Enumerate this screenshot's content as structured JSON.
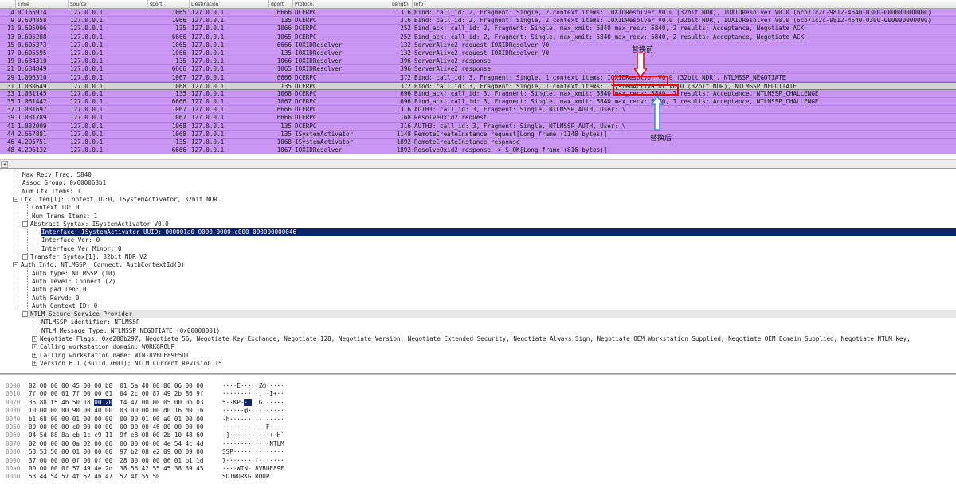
{
  "packet_list": {
    "columns": [
      "Time",
      "Source",
      "sport",
      "Destination",
      "dport",
      "Protoco.",
      "Length",
      "Info"
    ],
    "rows": [
      {
        "no": "4",
        "time": "0.165914",
        "src": "127.0.0.1",
        "sport": "1065",
        "dst": "127.0.0.1",
        "dport": "6666",
        "proto": "DCERPC",
        "len": "316",
        "info": "Bind: call_id: 2, Fragment: Single, 2 context items: IOXIDResolver V0.0 (32bit NDR), IOXIDResolver V0.0 (6cb71c2c-9812-4540-0300-000000000000)"
      },
      {
        "no": "9",
        "time": "0.604858",
        "src": "127.0.0.1",
        "sport": "1066",
        "dst": "127.0.0.1",
        "dport": "135",
        "proto": "DCERPC",
        "len": "316",
        "info": "Bind: call_id: 2, Fragment: Single, 2 context items: IOXIDResolver V0.0 (32bit NDR), IOXIDResolver V0.0 (6cb71c2c-9812-4540-0300-000000000000)"
      },
      {
        "no": "11",
        "time": "0.605006",
        "src": "127.0.0.1",
        "sport": "135",
        "dst": "127.0.0.1",
        "dport": "1066",
        "proto": "DCERPC",
        "len": "252",
        "info": "Bind_ack: call_id: 2, Fragment: Single, max_xmit: 5840 max_recv: 5840, 2 results: Acceptance, Negotiate ACK"
      },
      {
        "no": "13",
        "time": "0.605288",
        "src": "127.0.0.1",
        "sport": "6666",
        "dst": "127.0.0.1",
        "dport": "1065",
        "proto": "DCERPC",
        "len": "252",
        "info": "Bind_ack: call_id: 2, Fragment: Single, max_xmit: 5840 max_recv: 5840, 2 results: Acceptance, Negotiate ACK"
      },
      {
        "no": "15",
        "time": "0.605373",
        "src": "127.0.0.1",
        "sport": "1065",
        "dst": "127.0.0.1",
        "dport": "6666",
        "proto": "IOXIDResolver",
        "len": "132",
        "info": "ServerAlive2 request IOXIDResolver V0"
      },
      {
        "no": "17",
        "time": "0.605595",
        "src": "127.0.0.1",
        "sport": "1066",
        "dst": "127.0.0.1",
        "dport": "135",
        "proto": "IOXIDResolver",
        "len": "132",
        "info": "ServerAlive2 request IOXIDResolver V0"
      },
      {
        "no": "19",
        "time": "0.634310",
        "src": "127.0.0.1",
        "sport": "135",
        "dst": "127.0.0.1",
        "dport": "1066",
        "proto": "IOXIDResolver",
        "len": "396",
        "info": "ServerAlive2 response"
      },
      {
        "no": "21",
        "time": "0.634849",
        "src": "127.0.0.1",
        "sport": "6666",
        "dst": "127.0.0.1",
        "dport": "1065",
        "proto": "IOXIDResolver",
        "len": "396",
        "info": "ServerAlive2 response"
      },
      {
        "no": "29",
        "time": "1.006310",
        "src": "127.0.0.1",
        "sport": "1067",
        "dst": "127.0.0.1",
        "dport": "6666",
        "proto": "DCERPC",
        "len": "372",
        "info": "Bind: call_id: 3, Fragment: Single, 1 context items: IOXIDResolver V0.0 (32bit NDR), NTLMSSP_NEGOTIATE"
      },
      {
        "no": "31",
        "time": "1.030649",
        "src": "127.0.0.1",
        "sport": "1068",
        "dst": "127.0.0.1",
        "dport": "135",
        "proto": "DCERPC",
        "len": "372",
        "info": "Bind: call_id: 3, Fragment: Single, 1 context items: ISystemActivator V0.0 (32bit NDR), NTLMSSP_NEGOTIATE",
        "selected": true
      },
      {
        "no": "33",
        "time": "1.031145",
        "src": "127.0.0.1",
        "sport": "135",
        "dst": "127.0.0.1",
        "dport": "1068",
        "proto": "DCERPC",
        "len": "696",
        "info": "Bind_ack: call_id: 3, Fragment: Single, max_xmit: 5840 max_recv: 5840, 1 results: Acceptance, NTLMSSP_CHALLENGE"
      },
      {
        "no": "35",
        "time": "1.051442",
        "src": "127.0.0.1",
        "sport": "6666",
        "dst": "127.0.0.1",
        "dport": "1067",
        "proto": "DCERPC",
        "len": "696",
        "info": "Bind_ack: call_id: 3, Fragment: Single, max_xmit: 5840 max_recv: 5840, 1 results: Acceptance, NTLMSSP_CHALLENGE"
      },
      {
        "no": "37",
        "time": "1.031697",
        "src": "127.0.0.1",
        "sport": "1067",
        "dst": "127.0.0.1",
        "dport": "6666",
        "proto": "DCERPC",
        "len": "316",
        "info": "AUTH3: call_id: 3, Fragment: Single, NTLMSSP_AUTH, User: \\"
      },
      {
        "no": "39",
        "time": "1.031789",
        "src": "127.0.0.1",
        "sport": "1067",
        "dst": "127.0.0.1",
        "dport": "6666",
        "proto": "DCERPC",
        "len": "168",
        "info": "ResolveOxid2 request"
      },
      {
        "no": "41",
        "time": "1.032009",
        "src": "127.0.0.1",
        "sport": "1068",
        "dst": "127.0.0.1",
        "dport": "135",
        "proto": "DCERPC",
        "len": "316",
        "info": "AUTH3: call_id: 3, Fragment: Single, NTLMSSP_AUTH, User: \\"
      },
      {
        "no": "44",
        "time": "2.657881",
        "src": "127.0.0.1",
        "sport": "1068",
        "dst": "127.0.0.1",
        "dport": "135",
        "proto": "ISystemActivator",
        "len": "1148",
        "info": "RemoteCreateInstance request[Long frame (1148 bytes)]"
      },
      {
        "no": "46",
        "time": "4.295751",
        "src": "127.0.0.1",
        "sport": "135",
        "dst": "127.0.0.1",
        "dport": "1068",
        "proto": "ISystemActivator",
        "len": "1892",
        "info": "RemoteCreateInstance response"
      },
      {
        "no": "48",
        "time": "4.296132",
        "src": "127.0.0.1",
        "sport": "6666",
        "dst": "127.0.0.1",
        "dport": "1067",
        "proto": "IOXIDResolver",
        "len": "1892",
        "info": "ResolveOxid2 response -> S_OK[Long frame (816 bytes)]"
      }
    ]
  },
  "annotations": {
    "before_label": "替换前",
    "after_label": "替换后",
    "arrow_color": "#e01010",
    "arrow_after_color": "#3a8fe0"
  },
  "details": {
    "rows": [
      {
        "text": "Max Recv Frag: 5840"
      },
      {
        "text": "Assoc Group: 0x000068b1"
      },
      {
        "text": "Num Ctx Items: 1"
      },
      {
        "text": "Ctx Item[1]: Context ID:0, ISystemActivator, 32bit NDR",
        "exp": "-"
      },
      {
        "text": "Context ID: 0"
      },
      {
        "text": "Num Trans Items: 1"
      },
      {
        "text": "Abstract Syntax: ISystemActivator V0.0",
        "exp": "-"
      },
      {
        "text": "Interface: ISystemActivator UUID: 000001a0-0000-0000-c000-000000000046",
        "selected": true
      },
      {
        "text": "Interface Ver: 0"
      },
      {
        "text": "Interface Ver Minor: 0"
      },
      {
        "text": "Transfer Syntax[1]: 32bit NDR V2",
        "exp": "+"
      },
      {
        "text": "Auth Info: NTLMSSP, Connect, AuthContextId(0)",
        "exp": "-"
      },
      {
        "text": "Auth type: NTLMSSP (10)"
      },
      {
        "text": "Auth level: Connect (2)"
      },
      {
        "text": "Auth pad len: 0"
      },
      {
        "text": "Auth Rsrvd: 0"
      },
      {
        "text": "Auth Context ID: 0"
      },
      {
        "text": "NTLM Secure Service Provider",
        "exp": "-",
        "section": true
      },
      {
        "text": "NTLMSSP identifier: NTLMSSP"
      },
      {
        "text": "NTLM Message Type: NTLMSSP_NEGOTIATE (0x00000001)"
      },
      {
        "text": "Negotiate Flags: 0xe208b297, Negotiate 56, Negotiate Key Exchange, Negotiate 128, Negotiate Version, Negotiate Extended Security, Negotiate Always Sign, Negotiate OEM Workstation Supplied, Negotiate OEM Domain Supplied, Negotiate NTLM key,",
        "exp": "+"
      },
      {
        "text": "Calling workstation domain: WORKGROUP",
        "exp": "+"
      },
      {
        "text": "Calling workstation name: WIN-8VBUE89E5DT",
        "exp": "+"
      },
      {
        "text": "Version 6.1 (Build 7601); NTLM Current Revision 15",
        "exp": "+"
      }
    ]
  },
  "bytes": {
    "rows": [
      {
        "off": "0000",
        "hex": "02 00 00 00 45 00 00 b8  01 5a 40 00 80 06 00 00",
        "ascii": "····E··· ·Z@·····"
      },
      {
        "off": "0010",
        "hex": "7f 00 00 01 7f 00 00 01  04 2c 00 87 49 2b 86 9f",
        "ascii": "········ ·,··I+··"
      },
      {
        "off": "0020",
        "hex": "35 88 f5 4b 50 18 ",
        "hex_hl": "00 20",
        "hex_after": "  f4 47 00 00 05 00 0b 03",
        "ascii": "5··KP·",
        "ascii_hl": "· ",
        "ascii_after": " ·G······"
      },
      {
        "off": "0030",
        "hex": "10 00 00 00 90 00 40 00  03 00 00 00 d0 16 d0 16",
        "ascii": "······@· ········"
      },
      {
        "off": "0040",
        "hex": "b1 68 00 00 01 00 00 00  00 00 01 00 a0 01 00 00",
        "ascii": "·h······ ········"
      },
      {
        "off": "0050",
        "hex": "00 00 00 00 c0 00 00 00  00 00 00 46 00 00 00 00",
        "ascii": "········ ···F····"
      },
      {
        "off": "0060",
        "hex": "04 5d 88 8a eb 1c c9 11  9f e8 08 00 2b 10 48 60",
        "ascii": "·]······ ····+·H`"
      },
      {
        "off": "0070",
        "hex": "02 00 00 00 0a 02 00 00  00 00 00 00 4e 54 4c 4d",
        "ascii": "········ ····NTLM"
      },
      {
        "off": "0080",
        "hex": "53 53 50 00 01 00 00 00  97 b2 08 e2 09 00 09 00",
        "ascii": "SSP····· ········"
      },
      {
        "off": "0090",
        "hex": "37 00 00 00 0f 00 0f 00  28 00 00 00 06 01 b1 1d",
        "ascii": "7······· (·······"
      },
      {
        "off": "00a0",
        "hex": "00 00 00 0f 57 49 4e 2d  38 56 42 55 45 38 39 45",
        "ascii": "····WIN- 8VBUE89E"
      },
      {
        "off": "00b0",
        "hex": "53 44 54 57 4f 52 4b 47  52 4f 55 50",
        "ascii": "SDTWORKG ROUP"
      }
    ]
  }
}
